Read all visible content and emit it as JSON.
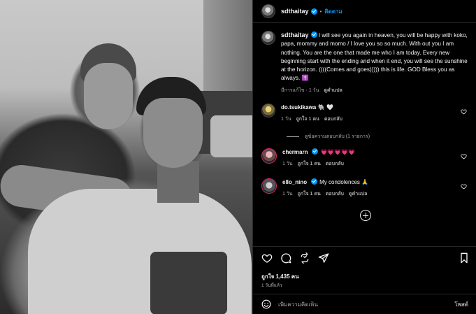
{
  "post": {
    "username": "sdthaitay",
    "follow_label": "ติดตาม",
    "separator": "•"
  },
  "caption": {
    "username": "sdthaitay",
    "text": "I will see you again in heaven, you will be happy with koko, papa, mommy and momo / I love you so so much. With out you I am nothing. You are the one that made me who I am today. Every new beginning start with the ending and when it end, you will see the sunshine at the horizon. ((((Comes and goes))))) this is life. GOD Bless you as always. ✝️",
    "edited_label": "มีการแก้ไข · 1 วัน",
    "translate_label": "ดูคำแปล"
  },
  "comments": [
    {
      "username": "do.tsukikawa",
      "text": "🐘 🤍",
      "time": "1 วัน",
      "likes": "ถูกใจ 1 คน",
      "reply": "ตอบกลับ",
      "view_replies": "ดูข้อความตอบกลับ (1 รายการ)"
    },
    {
      "username": "chermarn",
      "text": "💗💗💗💗💗",
      "time": "1 วัน",
      "likes": "ถูกใจ 1 คน",
      "reply": "ตอบกลับ"
    },
    {
      "username": "ello_nino",
      "text": "My condolences 🙏",
      "time": "1 วัน",
      "likes": "ถูกใจ 1 คน",
      "reply": "ตอบกลับ",
      "translate": "ดูคำแปล"
    }
  ],
  "stats": {
    "likes": "ถูกใจ 1,435 คน",
    "ago": "1 วันที่แล้ว"
  },
  "composer": {
    "placeholder": "เพิ่มความคิดเห็น",
    "post_label": "โพสต์"
  },
  "icons": {
    "actions": [
      "heart-icon",
      "comment-icon",
      "share-icon",
      "send-icon",
      "bookmark-icon"
    ],
    "emoji": "smiley-icon",
    "load_more": "plus-circle-icon",
    "verified": "verified-badge-icon"
  },
  "colors": {
    "background": "#000000",
    "accent": "#0095f6",
    "text": "#f5f5f5",
    "muted": "#a8a8a8",
    "heart_pink": "#ff3b7a"
  }
}
